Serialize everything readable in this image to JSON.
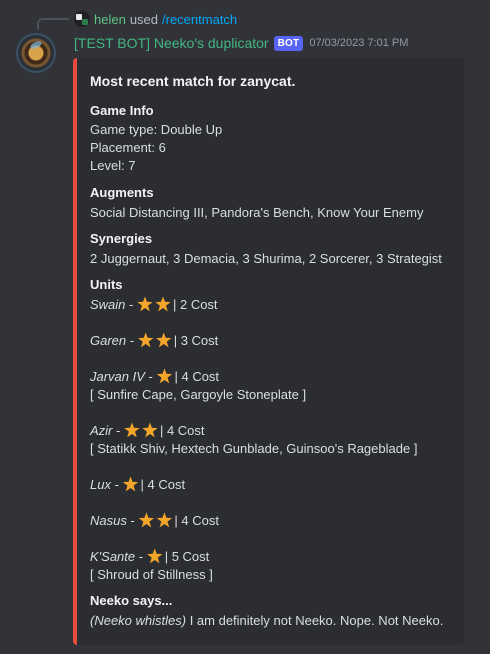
{
  "reply": {
    "username": "helen",
    "used_text": "used",
    "command": "/recentmatch"
  },
  "message": {
    "author": "[TEST BOT] Neeko's duplicator",
    "bot_tag": "BOT",
    "timestamp": "07/03/2023 7:01 PM"
  },
  "embed": {
    "accent_color": "#e74c3c",
    "title": "Most recent match for zanycat.",
    "game_info": {
      "heading": "Game Info",
      "lines": [
        "Game type: Double Up",
        "Placement: 6",
        "Level: 7"
      ]
    },
    "augments": {
      "heading": "Augments",
      "text": "Social Distancing III, Pandora's Bench, Know Your Enemy"
    },
    "synergies": {
      "heading": "Synergies",
      "text": "2 Juggernaut, 3 Demacia, 3 Shurima, 2 Sorcerer, 3 Strategist"
    },
    "units": {
      "heading": "Units",
      "list": [
        {
          "name": "Swain",
          "sep": " - ",
          "stars": 2,
          "cost": "| 2 Cost",
          "items": ""
        },
        {
          "name": "Garen",
          "sep": " - ",
          "stars": 2,
          "cost": "| 3 Cost",
          "items": ""
        },
        {
          "name": "Jarvan IV",
          "sep": " - ",
          "stars": 1,
          "cost": "| 4 Cost",
          "items": "[ Sunfire Cape, Gargoyle Stoneplate ]"
        },
        {
          "name": "Azir",
          "sep": " - ",
          "stars": 2,
          "cost": "| 4 Cost",
          "items": "[ Statikk Shiv, Hextech Gunblade, Guinsoo's Rageblade ]"
        },
        {
          "name": "Lux",
          "sep": " - ",
          "stars": 1,
          "cost": "| 4 Cost",
          "items": ""
        },
        {
          "name": "Nasus",
          "sep": " - ",
          "stars": 2,
          "cost": "| 4 Cost",
          "items": ""
        },
        {
          "name": "K'Sante",
          "sep": " - ",
          "stars": 1,
          "cost": "| 5 Cost",
          "items": "[ Shroud of Stillness ]"
        }
      ]
    },
    "neeko": {
      "heading": "Neeko says...",
      "action": "(Neeko whistles)",
      "text": " I am definitely not Neeko. Nope. Not Neeko."
    }
  }
}
